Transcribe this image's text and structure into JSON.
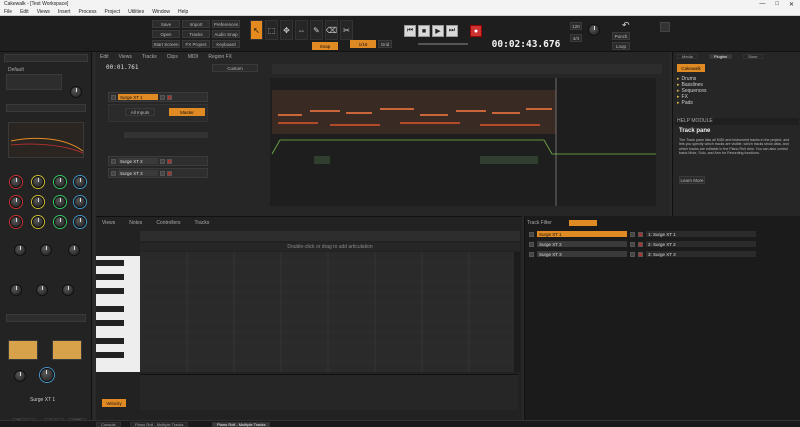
{
  "window": {
    "title": "Cakewalk - [Test Workspace]",
    "controls": [
      "—",
      "□",
      "✕"
    ]
  },
  "menu": [
    "File",
    "Edit",
    "Views",
    "Insert",
    "Process",
    "Project",
    "Utilities",
    "Window",
    "Help"
  ],
  "controlbar": {
    "quick_buttons": [
      "Save",
      "Import",
      "Preferences",
      "Open",
      "Tracks",
      "Audio Snap",
      "Start Screen",
      "FX Project",
      "Keyboard"
    ],
    "tool_labels": [
      "Smart",
      "Select",
      "Move",
      "Edit",
      "Draw",
      "Erase",
      "Split",
      "Comp"
    ],
    "snap_label": "Snap",
    "snap_value": "1/16",
    "grid_label": "Grid",
    "time_display": "00:02:43.676",
    "tempo": "120",
    "meter": "4/4",
    "marks": [
      "Loop",
      "Punch"
    ]
  },
  "inspector": {
    "preset_label": "Default",
    "track_name": "Surge XT 1",
    "bottom_tabs": [
      "Display",
      "Audio",
      "MIDI"
    ]
  },
  "trackview": {
    "menus": [
      "Edit",
      "Views",
      "Tracks",
      "Clips",
      "MIDI",
      "Region FX"
    ],
    "time": "00:01.761",
    "zoom_label": "Custom",
    "tracks": [
      {
        "name": "Surge XT 1",
        "selected": true
      },
      {
        "name": "Surge XT 2",
        "selected": false
      },
      {
        "name": "Surge XT 3",
        "selected": false
      }
    ],
    "input_label": "All Inputs",
    "output_label": "Master"
  },
  "browser": {
    "tabs": [
      "Media",
      "Plugins",
      "Store"
    ],
    "folder_selector": "Cakewalk",
    "folders": [
      "Drums",
      "Basslines",
      "Sequences",
      "FX",
      "Pads"
    ],
    "help_title": "HELP MODULE",
    "help_heading": "Track pane",
    "help_text": "The Track pane lists all MIDI and instrument tracks in the project, and lets you specify which tracks are visible, which tracks show data, and which tracks are editable in the Piano Roll view. You can also control basic Mute, Solo, and Arm for Recording functions.",
    "learn_more": "Learn More"
  },
  "pianoroll": {
    "menus": [
      "Views",
      "Notes",
      "Controllers",
      "Tracks"
    ],
    "hint": "Double-click or drag to add articulation",
    "controller_label": "Velocity"
  },
  "trackpane": {
    "filter_label": "Track Filter",
    "rows": [
      {
        "name": "Surge XT 1",
        "out": "1: Surge XT 1"
      },
      {
        "name": "Surge XT 2",
        "out": "2: Surge XT 2"
      },
      {
        "name": "Surge XT 3",
        "out": "3: Surge XT 3"
      }
    ]
  },
  "bottombar": {
    "tabs": [
      "Console",
      "Piano Roll - Multiple Tracks",
      "Piano Roll - Multiple Tracks"
    ]
  },
  "colors": {
    "accent": "#e08a24",
    "panel": "#262626",
    "dark": "#1e1e1e",
    "note": "#c9663a",
    "automation": "#77b84a"
  }
}
